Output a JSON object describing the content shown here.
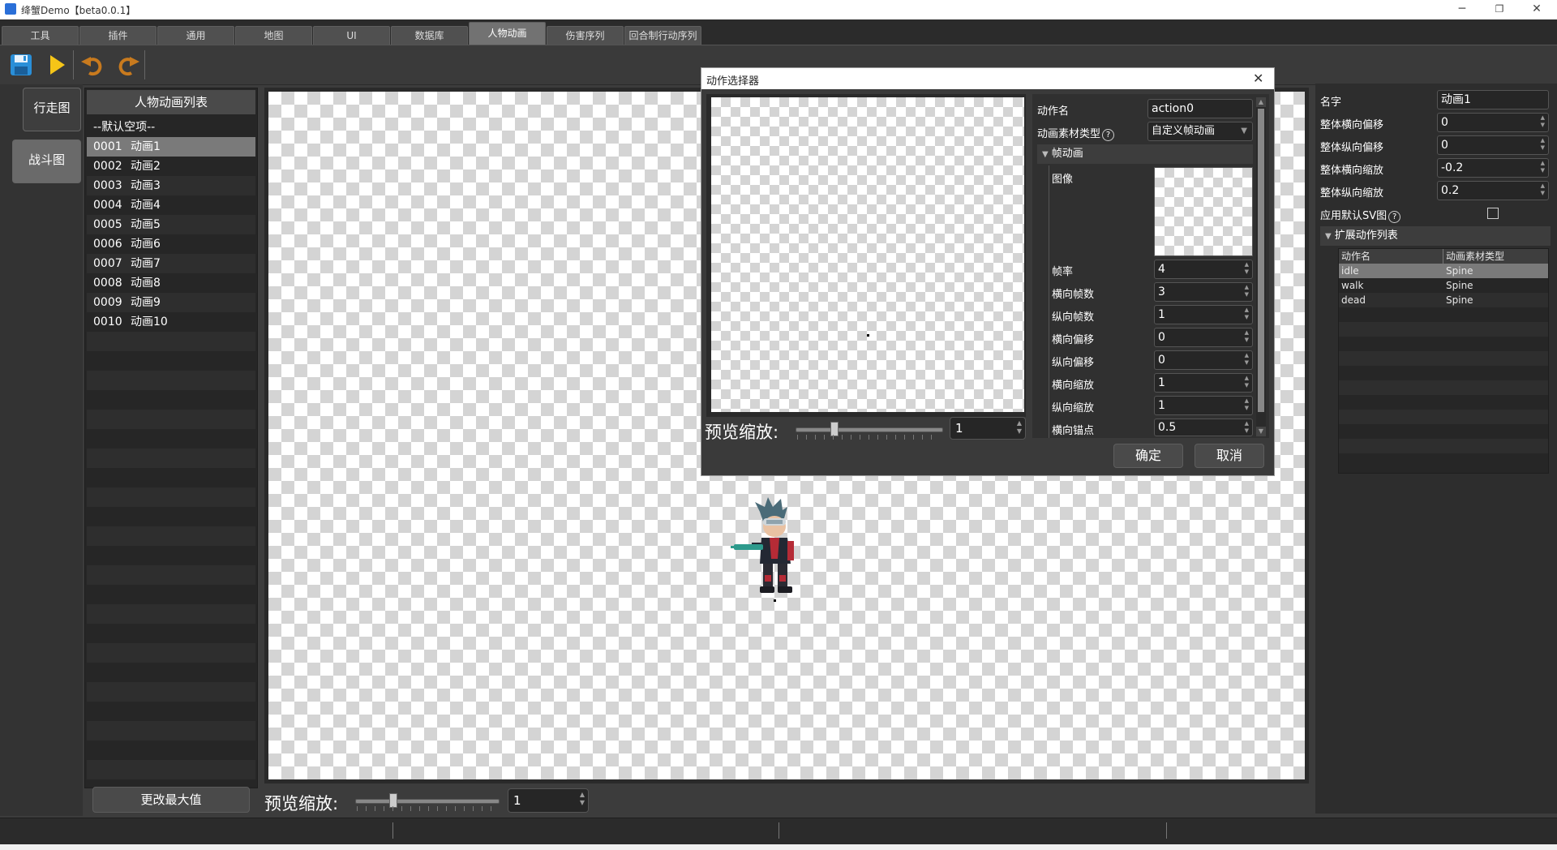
{
  "window": {
    "title": "绛蟹Demo【beta0.0.1】",
    "minimize": "─",
    "restore": "❐",
    "close": "✕"
  },
  "tabs": [
    "工具",
    "插件",
    "通用",
    "地图",
    "UI",
    "数据库",
    "人物动画",
    "伤害序列",
    "回合制行动序列"
  ],
  "active_tab": "人物动画",
  "toolbar": {
    "icons": [
      "save-icon",
      "play-icon",
      "undo-icon",
      "redo-icon"
    ]
  },
  "side_tabs": [
    "行走图",
    "战斗图"
  ],
  "list": {
    "header": "人物动画列表",
    "default_item": "--默认空项--",
    "items": [
      {
        "num": "0001",
        "label": "动画1"
      },
      {
        "num": "0002",
        "label": "动画2"
      },
      {
        "num": "0003",
        "label": "动画3"
      },
      {
        "num": "0004",
        "label": "动画4"
      },
      {
        "num": "0005",
        "label": "动画5"
      },
      {
        "num": "0006",
        "label": "动画6"
      },
      {
        "num": "0007",
        "label": "动画7"
      },
      {
        "num": "0008",
        "label": "动画8"
      },
      {
        "num": "0009",
        "label": "动画9"
      },
      {
        "num": "0010",
        "label": "动画10"
      }
    ],
    "max_button": "更改最大值"
  },
  "preview": {
    "zoom_label": "预览缩放:",
    "zoom_value": "1",
    "zoom_slider_level": 0.25
  },
  "properties": {
    "name_label": "名字",
    "name_value": "动画1",
    "offset_x_label": "整体横向偏移",
    "offset_x_value": "0",
    "offset_y_label": "整体纵向偏移",
    "offset_y_value": "0",
    "scale_x_label": "整体横向缩放",
    "scale_x_value": "-0.2",
    "scale_y_label": "整体纵向缩放",
    "scale_y_value": "0.2",
    "default_sv_label": "应用默认SV图",
    "help": "?",
    "ext_section": "扩展动作列表",
    "ext_columns": [
      "动作名",
      "动画素材类型"
    ],
    "ext_rows": [
      {
        "name": "idle",
        "type": "Spine"
      },
      {
        "name": "walk",
        "type": "Spine"
      },
      {
        "name": "dead",
        "type": "Spine"
      }
    ]
  },
  "dialog": {
    "title": "动作选择器",
    "close": "✕",
    "action_name_label": "动作名",
    "action_name_value": "action0",
    "material_type_label": "动画素材类型",
    "material_type_value": "自定义帧动画",
    "help": "?",
    "frame_section": "帧动画",
    "image_label": "图像",
    "fields": [
      {
        "label": "帧率",
        "value": "4"
      },
      {
        "label": "横向帧数",
        "value": "3"
      },
      {
        "label": "纵向帧数",
        "value": "1"
      },
      {
        "label": "横向偏移",
        "value": "0"
      },
      {
        "label": "纵向偏移",
        "value": "0"
      },
      {
        "label": "横向缩放",
        "value": "1"
      },
      {
        "label": "纵向缩放",
        "value": "1"
      },
      {
        "label": "横向锚点",
        "value": "0.5"
      }
    ],
    "zoom_label": "预览缩放:",
    "zoom_value": "1",
    "zoom_slider_level": 0.25,
    "ok": "确定",
    "cancel": "取消"
  },
  "colors": {
    "accent_save": "#2a8fd8",
    "accent_play": "#f5c518",
    "undo": "#c87a1e"
  }
}
